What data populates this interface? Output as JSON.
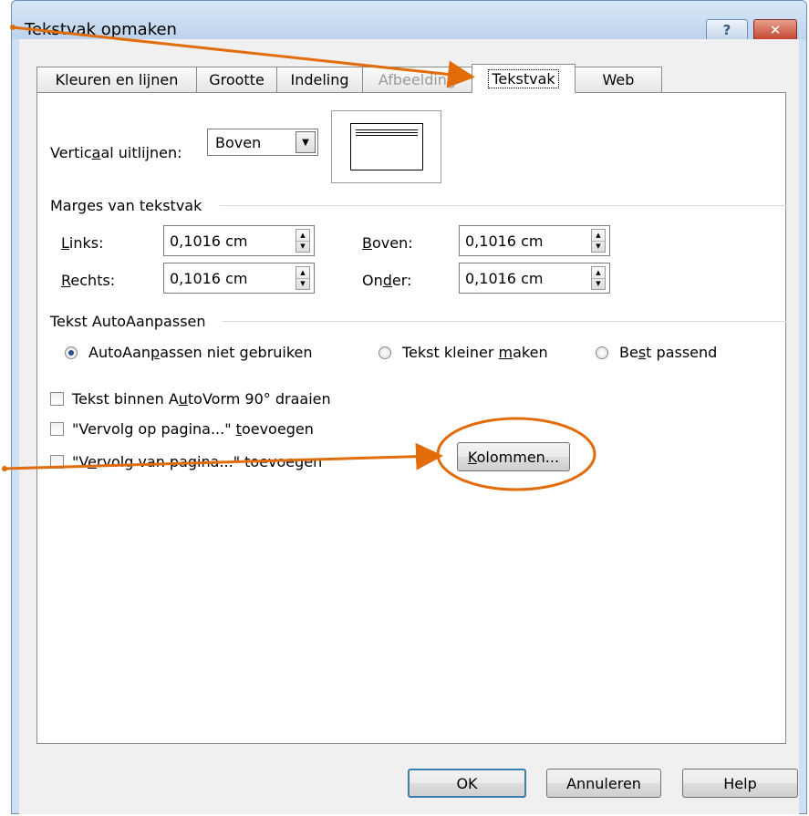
{
  "window": {
    "title": "Tekstvak opmaken",
    "help_glyph": "?",
    "close_glyph": "✕"
  },
  "tabs": [
    {
      "label": "Kleuren en lijnen",
      "state": "normal"
    },
    {
      "label": "Grootte",
      "state": "normal"
    },
    {
      "label": "Indeling",
      "state": "normal"
    },
    {
      "label": "Afbeelding",
      "state": "disabled"
    },
    {
      "label": "Tekstvak",
      "state": "active"
    },
    {
      "label": "Web",
      "state": "normal"
    }
  ],
  "vertical_align": {
    "label_pre": "Vertic",
    "label_accel": "a",
    "label_post": "al uitlijnen:",
    "value": "Boven"
  },
  "margins": {
    "group_label": "Marges van tekstvak",
    "left": {
      "accel": "L",
      "rest": "inks:",
      "value": "0,1016 cm"
    },
    "right": {
      "accel": "R",
      "rest": "echts:",
      "value": "0,1016 cm"
    },
    "top": {
      "accel": "B",
      "rest": "oven:",
      "value": "0,1016 cm"
    },
    "bottom": {
      "pre": "On",
      "accel": "d",
      "rest": "er:",
      "value": "0,1016 cm"
    }
  },
  "autofit": {
    "group_label": "Tekst AutoAanpassen",
    "options": [
      {
        "pre": "AutoAan",
        "accel": "p",
        "post": "assen niet gebruiken",
        "checked": true
      },
      {
        "pre": "Tekst kleiner ",
        "accel": "m",
        "post": "aken",
        "checked": false
      },
      {
        "pre": "Be",
        "accel": "s",
        "post": "t passend",
        "checked": false
      }
    ]
  },
  "checkboxes": [
    {
      "pre": "Tekst binnen A",
      "accel": "u",
      "post": "toVorm 90° draaien",
      "checked": false
    },
    {
      "pre": "\"Vervolg op pagina...\" ",
      "accel": "t",
      "post": "oevoegen",
      "checked": false
    },
    {
      "pre": "\"V",
      "accel": "e",
      "post": "rvolg van pagina...\" toevoegen",
      "checked": false
    }
  ],
  "columns_button": {
    "accel": "K",
    "rest": "olommen..."
  },
  "footer": {
    "ok": "OK",
    "cancel": "Annuleren",
    "help": "Help"
  },
  "annotation_color": "#e26b0a"
}
